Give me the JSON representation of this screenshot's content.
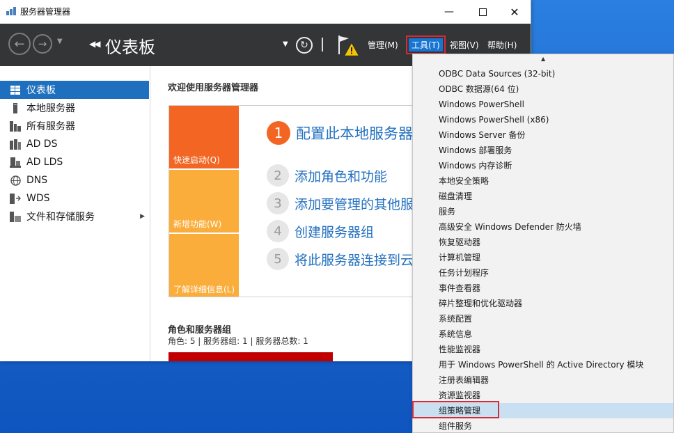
{
  "window": {
    "title": "服务器管理器"
  },
  "toolbar": {
    "page_title": "仪表板",
    "menus": [
      "管理(M)",
      "工具(T)",
      "视图(V)",
      "帮助(H)"
    ]
  },
  "sidebar": {
    "items": [
      {
        "label": "仪表板",
        "icon": "dashboard-icon"
      },
      {
        "label": "本地服务器",
        "icon": "server-icon"
      },
      {
        "label": "所有服务器",
        "icon": "servers-icon"
      },
      {
        "label": "AD DS",
        "icon": "ad-ds-icon"
      },
      {
        "label": "AD LDS",
        "icon": "ad-lds-icon"
      },
      {
        "label": "DNS",
        "icon": "dns-icon"
      },
      {
        "label": "WDS",
        "icon": "wds-icon"
      },
      {
        "label": "文件和存储服务",
        "icon": "storage-icon"
      }
    ]
  },
  "main": {
    "welcome": "欢迎使用服务器管理器",
    "tiles": [
      "快速启动(Q)",
      "新增功能(W)",
      "了解详细信息(L)"
    ],
    "steps": [
      {
        "num": "1",
        "text": "配置此本地服务器"
      },
      {
        "num": "2",
        "text": "添加角色和功能"
      },
      {
        "num": "3",
        "text": "添加要管理的其他服务器"
      },
      {
        "num": "4",
        "text": "创建服务器组"
      },
      {
        "num": "5",
        "text": "将此服务器连接到云服务"
      }
    ],
    "roles_title": "角色和服务器组",
    "roles_summary": "角色: 5 | 服务器组: 1 | 服务器总数: 1"
  },
  "tools_menu": {
    "items": [
      "ODBC Data Sources (32-bit)",
      "ODBC 数据源(64 位)",
      "Windows PowerShell",
      "Windows PowerShell (x86)",
      "Windows Server 备份",
      "Windows 部署服务",
      "Windows 内存诊断",
      "本地安全策略",
      "磁盘清理",
      "服务",
      "高级安全 Windows Defender 防火墙",
      "恢复驱动器",
      "计算机管理",
      "任务计划程序",
      "事件查看器",
      "碎片整理和优化驱动器",
      "系统配置",
      "系统信息",
      "性能监视器",
      "用于 Windows PowerShell 的 Active Directory 模块",
      "注册表编辑器",
      "资源监视器",
      "组策略管理",
      "组件服务"
    ],
    "highlighted_index": 22
  },
  "colors": {
    "accent": "#1e6fbd",
    "toolbar": "#333537",
    "tile_orange": "#f26522",
    "tile_amber": "#fbad3b",
    "highlight_border": "#d42b3b"
  }
}
